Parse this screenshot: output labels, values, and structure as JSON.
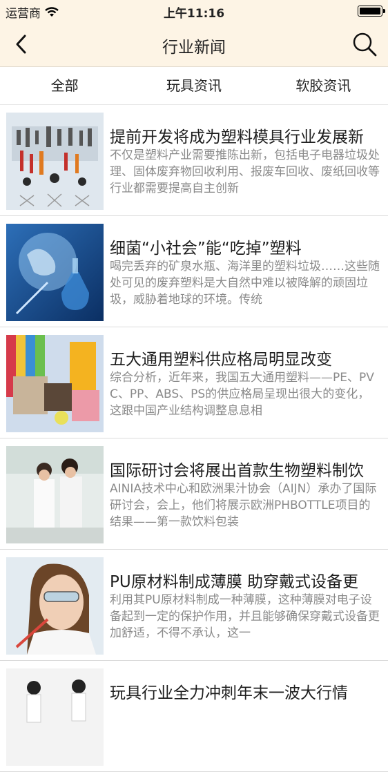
{
  "status_bar": {
    "carrier": "运营商",
    "time": "上午11:16"
  },
  "header": {
    "title": "行业新闻",
    "back_icon": "chevron-left-icon",
    "search_icon": "search-icon"
  },
  "tabs": [
    {
      "label": "全部"
    },
    {
      "label": "玩具资讯"
    },
    {
      "label": "软胶资讯"
    }
  ],
  "articles": [
    {
      "title": "提前开发将成为塑料模具行业发展新",
      "summary": "不仅是塑料产业需要推陈出新，包括电子电器垃圾处理、固体废弃物回收利用、报废车回收、废纸回收等行业都需要提高自主创新"
    },
    {
      "title": "细菌“小社会”能“吃掉”塑料",
      "summary": "喝完丢弃的矿泉水瓶、海洋里的塑料垃圾……这些随处可见的废弃塑料是大自然中难以被降解的顽固垃圾，威胁着地球的环境。传统"
    },
    {
      "title": "五大通用塑料供应格局明显改变",
      "summary": "综合分析，近年来，我国五大通用塑料——PE、PVC、PP、ABS、PS的供应格局呈现出很大的变化，这跟中国产业结构调整息息相"
    },
    {
      "title": "国际研讨会将展出首款生物塑料制饮",
      "summary": "AINIA技术中心和欧洲果汁协会（AIJN）承办了国际研讨会，会上，他们将展示欧洲PHBOTTLE项目的结果——第一款饮料包装"
    },
    {
      "title": "PU原材料制成薄膜 助穿戴式设备更",
      "summary": "利用其PU原材料制成一种薄膜，这种薄膜对电子设备起到一定的保护作用，并且能够确保穿戴式设备更加舒适，不得不承认，这一"
    },
    {
      "title": "玩具行业全力冲刺年末一波大行情",
      "summary": ""
    }
  ]
}
